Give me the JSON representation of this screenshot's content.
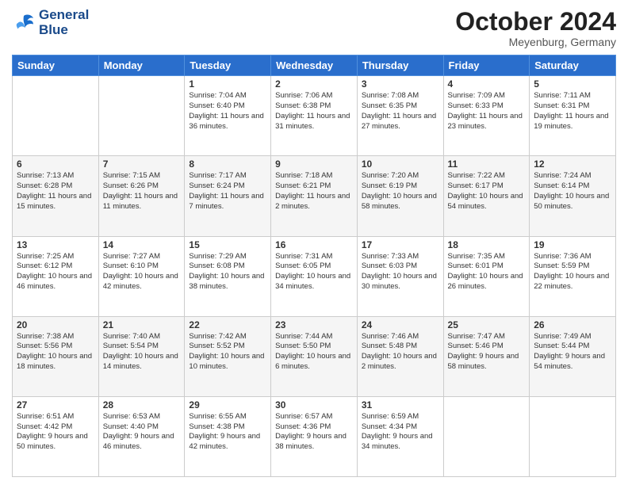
{
  "header": {
    "logo_line1": "General",
    "logo_line2": "Blue",
    "month_title": "October 2024",
    "location": "Meyenburg, Germany"
  },
  "days_of_week": [
    "Sunday",
    "Monday",
    "Tuesday",
    "Wednesday",
    "Thursday",
    "Friday",
    "Saturday"
  ],
  "weeks": [
    [
      {
        "day": "",
        "sunrise": "",
        "sunset": "",
        "daylight": ""
      },
      {
        "day": "",
        "sunrise": "",
        "sunset": "",
        "daylight": ""
      },
      {
        "day": "1",
        "sunrise": "Sunrise: 7:04 AM",
        "sunset": "Sunset: 6:40 PM",
        "daylight": "Daylight: 11 hours and 36 minutes."
      },
      {
        "day": "2",
        "sunrise": "Sunrise: 7:06 AM",
        "sunset": "Sunset: 6:38 PM",
        "daylight": "Daylight: 11 hours and 31 minutes."
      },
      {
        "day": "3",
        "sunrise": "Sunrise: 7:08 AM",
        "sunset": "Sunset: 6:35 PM",
        "daylight": "Daylight: 11 hours and 27 minutes."
      },
      {
        "day": "4",
        "sunrise": "Sunrise: 7:09 AM",
        "sunset": "Sunset: 6:33 PM",
        "daylight": "Daylight: 11 hours and 23 minutes."
      },
      {
        "day": "5",
        "sunrise": "Sunrise: 7:11 AM",
        "sunset": "Sunset: 6:31 PM",
        "daylight": "Daylight: 11 hours and 19 minutes."
      }
    ],
    [
      {
        "day": "6",
        "sunrise": "Sunrise: 7:13 AM",
        "sunset": "Sunset: 6:28 PM",
        "daylight": "Daylight: 11 hours and 15 minutes."
      },
      {
        "day": "7",
        "sunrise": "Sunrise: 7:15 AM",
        "sunset": "Sunset: 6:26 PM",
        "daylight": "Daylight: 11 hours and 11 minutes."
      },
      {
        "day": "8",
        "sunrise": "Sunrise: 7:17 AM",
        "sunset": "Sunset: 6:24 PM",
        "daylight": "Daylight: 11 hours and 7 minutes."
      },
      {
        "day": "9",
        "sunrise": "Sunrise: 7:18 AM",
        "sunset": "Sunset: 6:21 PM",
        "daylight": "Daylight: 11 hours and 2 minutes."
      },
      {
        "day": "10",
        "sunrise": "Sunrise: 7:20 AM",
        "sunset": "Sunset: 6:19 PM",
        "daylight": "Daylight: 10 hours and 58 minutes."
      },
      {
        "day": "11",
        "sunrise": "Sunrise: 7:22 AM",
        "sunset": "Sunset: 6:17 PM",
        "daylight": "Daylight: 10 hours and 54 minutes."
      },
      {
        "day": "12",
        "sunrise": "Sunrise: 7:24 AM",
        "sunset": "Sunset: 6:14 PM",
        "daylight": "Daylight: 10 hours and 50 minutes."
      }
    ],
    [
      {
        "day": "13",
        "sunrise": "Sunrise: 7:25 AM",
        "sunset": "Sunset: 6:12 PM",
        "daylight": "Daylight: 10 hours and 46 minutes."
      },
      {
        "day": "14",
        "sunrise": "Sunrise: 7:27 AM",
        "sunset": "Sunset: 6:10 PM",
        "daylight": "Daylight: 10 hours and 42 minutes."
      },
      {
        "day": "15",
        "sunrise": "Sunrise: 7:29 AM",
        "sunset": "Sunset: 6:08 PM",
        "daylight": "Daylight: 10 hours and 38 minutes."
      },
      {
        "day": "16",
        "sunrise": "Sunrise: 7:31 AM",
        "sunset": "Sunset: 6:05 PM",
        "daylight": "Daylight: 10 hours and 34 minutes."
      },
      {
        "day": "17",
        "sunrise": "Sunrise: 7:33 AM",
        "sunset": "Sunset: 6:03 PM",
        "daylight": "Daylight: 10 hours and 30 minutes."
      },
      {
        "day": "18",
        "sunrise": "Sunrise: 7:35 AM",
        "sunset": "Sunset: 6:01 PM",
        "daylight": "Daylight: 10 hours and 26 minutes."
      },
      {
        "day": "19",
        "sunrise": "Sunrise: 7:36 AM",
        "sunset": "Sunset: 5:59 PM",
        "daylight": "Daylight: 10 hours and 22 minutes."
      }
    ],
    [
      {
        "day": "20",
        "sunrise": "Sunrise: 7:38 AM",
        "sunset": "Sunset: 5:56 PM",
        "daylight": "Daylight: 10 hours and 18 minutes."
      },
      {
        "day": "21",
        "sunrise": "Sunrise: 7:40 AM",
        "sunset": "Sunset: 5:54 PM",
        "daylight": "Daylight: 10 hours and 14 minutes."
      },
      {
        "day": "22",
        "sunrise": "Sunrise: 7:42 AM",
        "sunset": "Sunset: 5:52 PM",
        "daylight": "Daylight: 10 hours and 10 minutes."
      },
      {
        "day": "23",
        "sunrise": "Sunrise: 7:44 AM",
        "sunset": "Sunset: 5:50 PM",
        "daylight": "Daylight: 10 hours and 6 minutes."
      },
      {
        "day": "24",
        "sunrise": "Sunrise: 7:46 AM",
        "sunset": "Sunset: 5:48 PM",
        "daylight": "Daylight: 10 hours and 2 minutes."
      },
      {
        "day": "25",
        "sunrise": "Sunrise: 7:47 AM",
        "sunset": "Sunset: 5:46 PM",
        "daylight": "Daylight: 9 hours and 58 minutes."
      },
      {
        "day": "26",
        "sunrise": "Sunrise: 7:49 AM",
        "sunset": "Sunset: 5:44 PM",
        "daylight": "Daylight: 9 hours and 54 minutes."
      }
    ],
    [
      {
        "day": "27",
        "sunrise": "Sunrise: 6:51 AM",
        "sunset": "Sunset: 4:42 PM",
        "daylight": "Daylight: 9 hours and 50 minutes."
      },
      {
        "day": "28",
        "sunrise": "Sunrise: 6:53 AM",
        "sunset": "Sunset: 4:40 PM",
        "daylight": "Daylight: 9 hours and 46 minutes."
      },
      {
        "day": "29",
        "sunrise": "Sunrise: 6:55 AM",
        "sunset": "Sunset: 4:38 PM",
        "daylight": "Daylight: 9 hours and 42 minutes."
      },
      {
        "day": "30",
        "sunrise": "Sunrise: 6:57 AM",
        "sunset": "Sunset: 4:36 PM",
        "daylight": "Daylight: 9 hours and 38 minutes."
      },
      {
        "day": "31",
        "sunrise": "Sunrise: 6:59 AM",
        "sunset": "Sunset: 4:34 PM",
        "daylight": "Daylight: 9 hours and 34 minutes."
      },
      {
        "day": "",
        "sunrise": "",
        "sunset": "",
        "daylight": ""
      },
      {
        "day": "",
        "sunrise": "",
        "sunset": "",
        "daylight": ""
      }
    ]
  ]
}
